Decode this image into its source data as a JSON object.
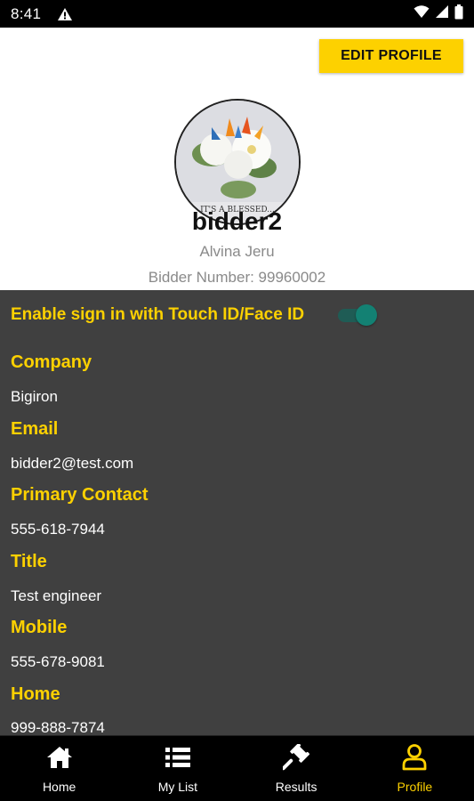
{
  "status_bar": {
    "time": "8:41",
    "icons": [
      "alert-icon",
      "wifi-icon",
      "signal-icon",
      "battery-icon"
    ]
  },
  "header": {
    "edit_button": "EDIT PROFILE",
    "username": "bidder2",
    "full_name": "Alvina Jeru",
    "bidder_number": "Bidder Number: 99960002",
    "avatar_caption": "IT'S A BLESSED..."
  },
  "settings": {
    "touch_id_label": "Enable sign in with Touch ID/Face ID",
    "touch_id_enabled": true
  },
  "fields": [
    {
      "label": "Company",
      "value": "Bigiron"
    },
    {
      "label": "Email",
      "value": "bidder2@test.com"
    },
    {
      "label": "Primary Contact",
      "value": "555-618-7944"
    },
    {
      "label": "Title",
      "value": "Test engineer"
    },
    {
      "label": "Mobile",
      "value": "555-678-9081"
    },
    {
      "label": "Home",
      "value": "999-888-7874"
    }
  ],
  "nav": {
    "items": [
      {
        "label": "Home",
        "icon": "home-icon"
      },
      {
        "label": "My List",
        "icon": "list-icon"
      },
      {
        "label": "Results",
        "icon": "gavel-icon"
      },
      {
        "label": "Profile",
        "icon": "person-icon"
      }
    ],
    "active": "Profile"
  },
  "colors": {
    "accent": "#fdd100",
    "dark_bg": "#404040",
    "toggle": "#138173"
  }
}
